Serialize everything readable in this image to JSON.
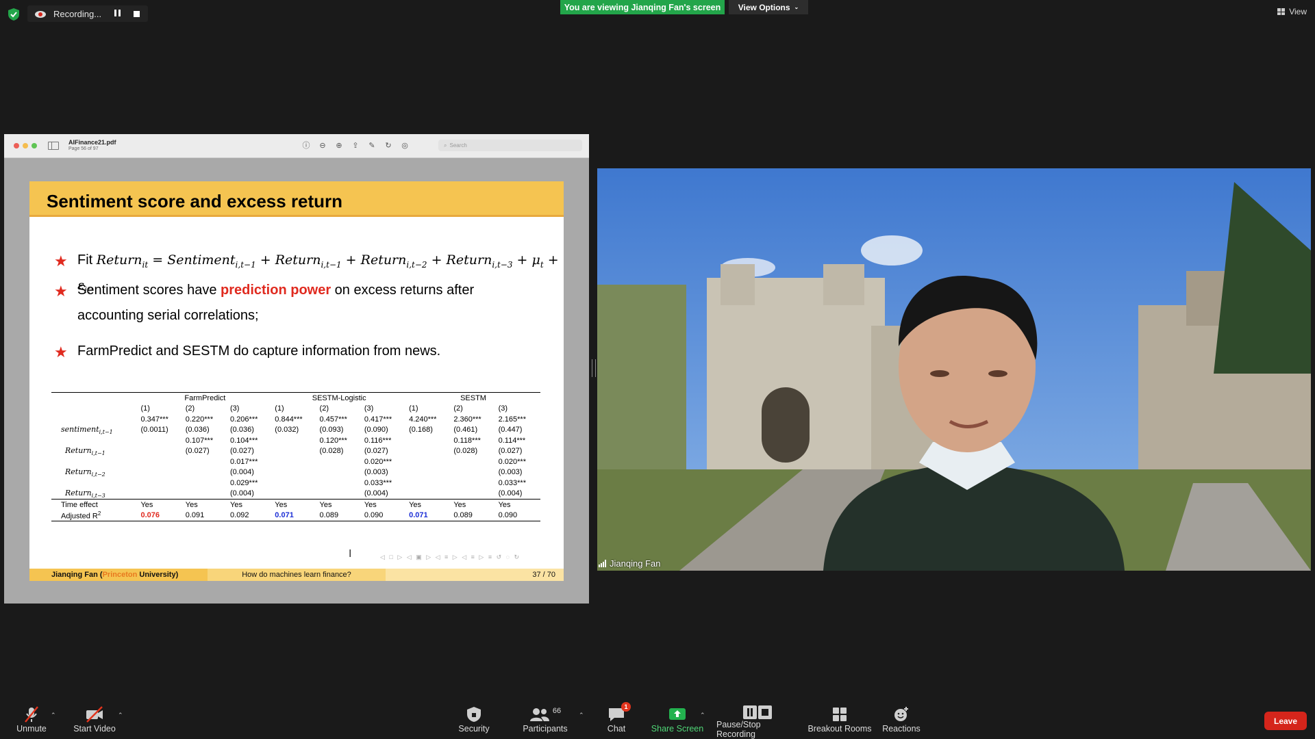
{
  "topbar": {
    "recording_label": "Recording...",
    "viewing_banner": "You are viewing Jianqing Fan's screen",
    "view_options": "View Options",
    "view": "View"
  },
  "pdf": {
    "filename": "AIFinance21.pdf",
    "page_info": "Page 56 of 97",
    "search_placeholder": "Search"
  },
  "slide": {
    "title": "Sentiment score and excess return",
    "bullet1_prefix": "Fit",
    "bullet2_pre": "Sentiment scores have ",
    "bullet2_hl": "prediction power",
    "bullet2_post": " on excess returns after accounting serial correlations;",
    "bullet3": "FarmPredict and SESTM do capture information from news.",
    "table": {
      "groups": [
        "FarmPredict",
        "SESTM-Logistic",
        "SESTM"
      ],
      "col_nums": [
        "(1)",
        "(2)",
        "(3)",
        "(1)",
        "(2)",
        "(3)",
        "(1)",
        "(2)",
        "(3)"
      ],
      "rows": [
        {
          "label": "",
          "cells": [
            "0.347***",
            "0.220***",
            "0.206***",
            "0.844***",
            "0.457***",
            "0.417***",
            "4.240***",
            "2.360***",
            "2.165***"
          ]
        },
        {
          "label": "sentiment",
          "cells": [
            "(0.0011)",
            "(0.036)",
            "(0.036)",
            "(0.032)",
            "(0.093)",
            "(0.090)",
            "(0.168)",
            "(0.461)",
            "(0.447)"
          ]
        },
        {
          "label": "",
          "cells": [
            "",
            "0.107***",
            "0.104***",
            "",
            "0.120***",
            "0.116***",
            "",
            "0.118***",
            "0.114***"
          ]
        },
        {
          "label": "Return",
          "cells": [
            "",
            "(0.027)",
            "(0.027)",
            "",
            "(0.028)",
            "(0.027)",
            "",
            "(0.028)",
            "(0.027)"
          ]
        },
        {
          "label": "",
          "cells": [
            "",
            "",
            "0.017***",
            "",
            "",
            "0.020***",
            "",
            "",
            "0.020***"
          ]
        },
        {
          "label": "Return",
          "cells": [
            "",
            "",
            "(0.004)",
            "",
            "",
            "(0.003)",
            "",
            "",
            "(0.003)"
          ]
        },
        {
          "label": "",
          "cells": [
            "",
            "",
            "0.029***",
            "",
            "",
            "0.033***",
            "",
            "",
            "0.033***"
          ]
        },
        {
          "label": "Return",
          "cells": [
            "",
            "",
            "(0.004)",
            "",
            "",
            "(0.004)",
            "",
            "",
            "(0.004)"
          ]
        }
      ],
      "time_effect_label": "Time effect",
      "time_effect": [
        "Yes",
        "Yes",
        "Yes",
        "Yes",
        "Yes",
        "Yes",
        "Yes",
        "Yes",
        "Yes"
      ],
      "adj_r2_label": "Adjusted R",
      "adj_r2": [
        "0.076",
        "0.091",
        "0.092",
        "0.071",
        "0.089",
        "0.090",
        "0.071",
        "0.089",
        "0.090"
      ]
    },
    "footer_author": "Jianqing Fan",
    "footer_affil_hl": "Princeton",
    "footer_affil_rest": "University)",
    "footer_title": "How do machines learn finance?",
    "footer_page": "37 / 70"
  },
  "video": {
    "speaker_name": "Jianqing Fan"
  },
  "controls": {
    "unmute": "Unmute",
    "start_video": "Start Video",
    "security": "Security",
    "participants": "Participants",
    "participants_count": "66",
    "chat": "Chat",
    "chat_badge": "1",
    "share_screen": "Share Screen",
    "pause_stop": "Pause/Stop Recording",
    "breakout": "Breakout Rooms",
    "reactions": "Reactions",
    "leave": "Leave"
  },
  "colors": {
    "banner_green": "#23a54a",
    "slide_yellow": "#f5c451",
    "highlight_red": "#e02a1f",
    "highlight_blue": "#1b2ed6",
    "leave_red": "#d5251b"
  }
}
